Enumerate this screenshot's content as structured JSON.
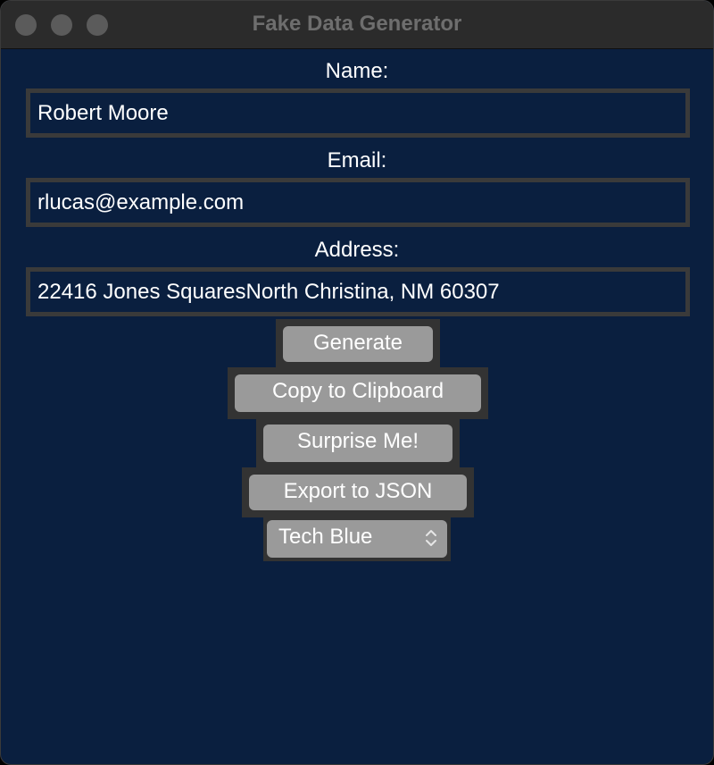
{
  "window": {
    "title": "Fake Data Generator"
  },
  "form": {
    "name_label": "Name:",
    "name_value": "Robert Moore",
    "email_label": "Email:",
    "email_value": "rlucas@example.com",
    "address_label": "Address:",
    "address_value": "22416 Jones SquaresNorth Christina, NM 60307"
  },
  "buttons": {
    "generate": "Generate",
    "copy": "Copy to Clipboard",
    "surprise": "Surprise Me!",
    "export": "Export to JSON"
  },
  "theme_select": {
    "selected": "Tech Blue"
  },
  "icons": {
    "chevron": "chevron-updown-icon"
  },
  "colors": {
    "background": "#0a1f3f",
    "button": "#9a9a9a",
    "button_frame": "#333333",
    "text": "#ffffff"
  }
}
